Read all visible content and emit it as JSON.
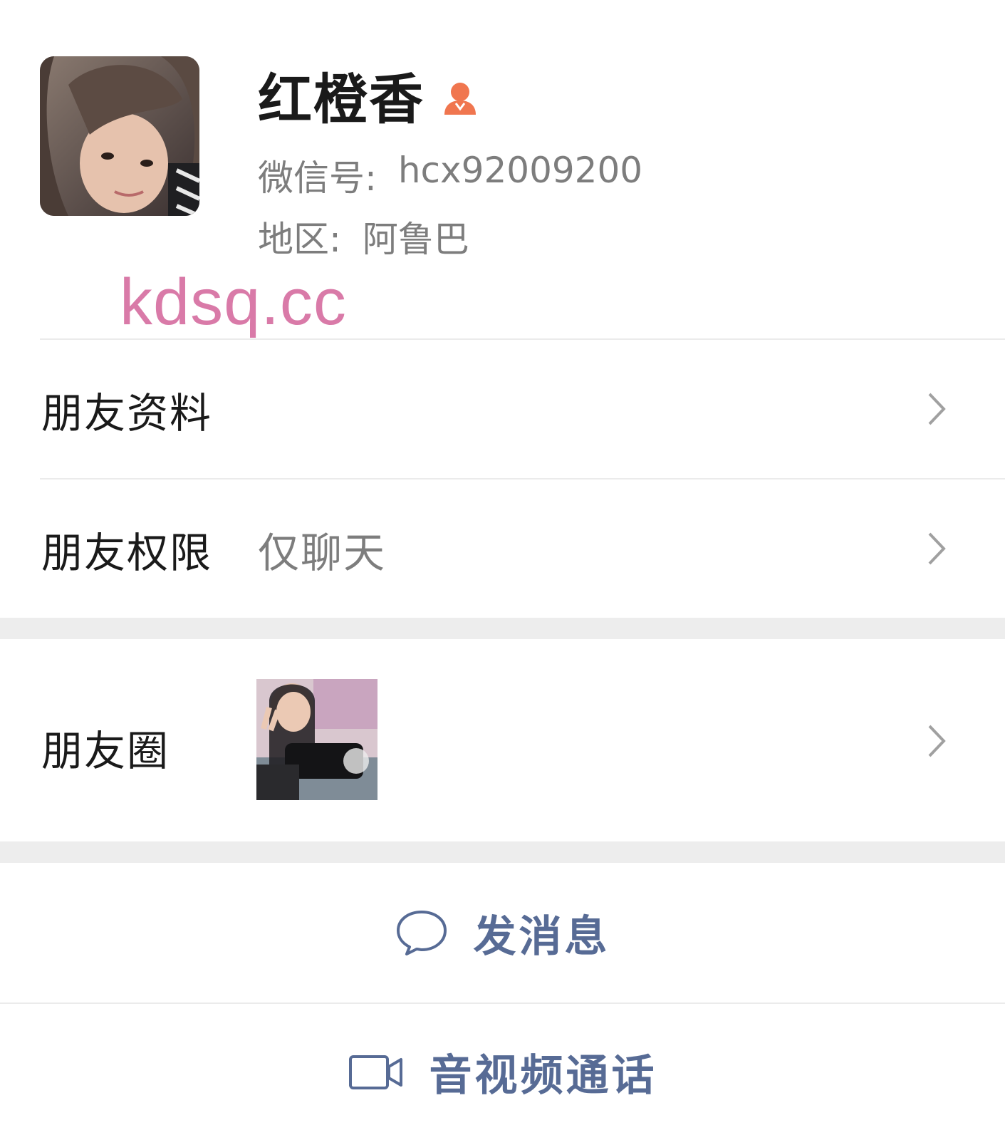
{
  "profile": {
    "name": "红橙香",
    "gender_icon": "female-icon",
    "wechat_id_label": "微信号:",
    "wechat_id": "hcx92009200",
    "region_label": "地区:",
    "region": "阿鲁巴"
  },
  "watermark": "kdsq.cc",
  "rows": {
    "friend_info": {
      "label": "朋友资料"
    },
    "friend_permission": {
      "label": "朋友权限",
      "value": "仅聊天"
    },
    "moments": {
      "label": "朋友圈"
    }
  },
  "actions": {
    "message": {
      "label": "发消息",
      "icon": "chat-bubble-icon"
    },
    "call": {
      "label": "音视频通话",
      "icon": "video-camera-icon"
    }
  },
  "colors": {
    "accent_link": "#576b95",
    "gender_female": "#f0764f",
    "watermark": "#d97aa8",
    "separator": "#ededed"
  }
}
